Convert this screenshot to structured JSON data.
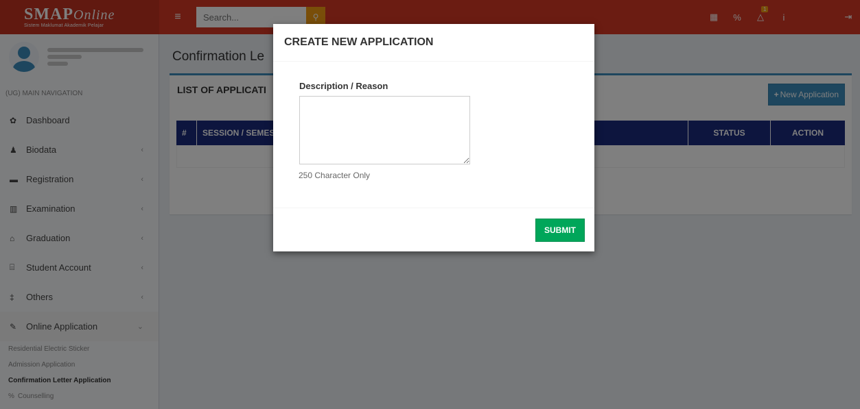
{
  "header": {
    "logo_main": "SMAP",
    "logo_script": "Online",
    "logo_sub": "Sistem Maklumat Akademik Pelajar",
    "search_placeholder": "Search...",
    "notification_count": "1"
  },
  "sidebar": {
    "nav_header": "(UG) MAIN NAVIGATION",
    "items": [
      {
        "label": "Dashboard"
      },
      {
        "label": "Biodata"
      },
      {
        "label": "Registration"
      },
      {
        "label": "Examination"
      },
      {
        "label": "Graduation"
      },
      {
        "label": "Student Account"
      },
      {
        "label": "Others"
      },
      {
        "label": "Online Application"
      }
    ],
    "sub_items": [
      {
        "label": "Residential Electric Sticker"
      },
      {
        "label": "Admission Application"
      },
      {
        "label": "Confirmation Letter Application"
      },
      {
        "label": "Counselling"
      }
    ]
  },
  "main": {
    "page_title": "Confirmation Le",
    "box_title": "LIST OF APPLICATI",
    "new_button_label": "New Application",
    "table_headers": [
      "#",
      "SESSION / SEMES",
      "STATUS",
      "ACTION"
    ]
  },
  "modal": {
    "title": "CREATE NEW APPLICATION",
    "field_label": "Description / Reason",
    "field_value": "",
    "help_text": "250 Character Only",
    "submit_label": "SUBMIT"
  }
}
